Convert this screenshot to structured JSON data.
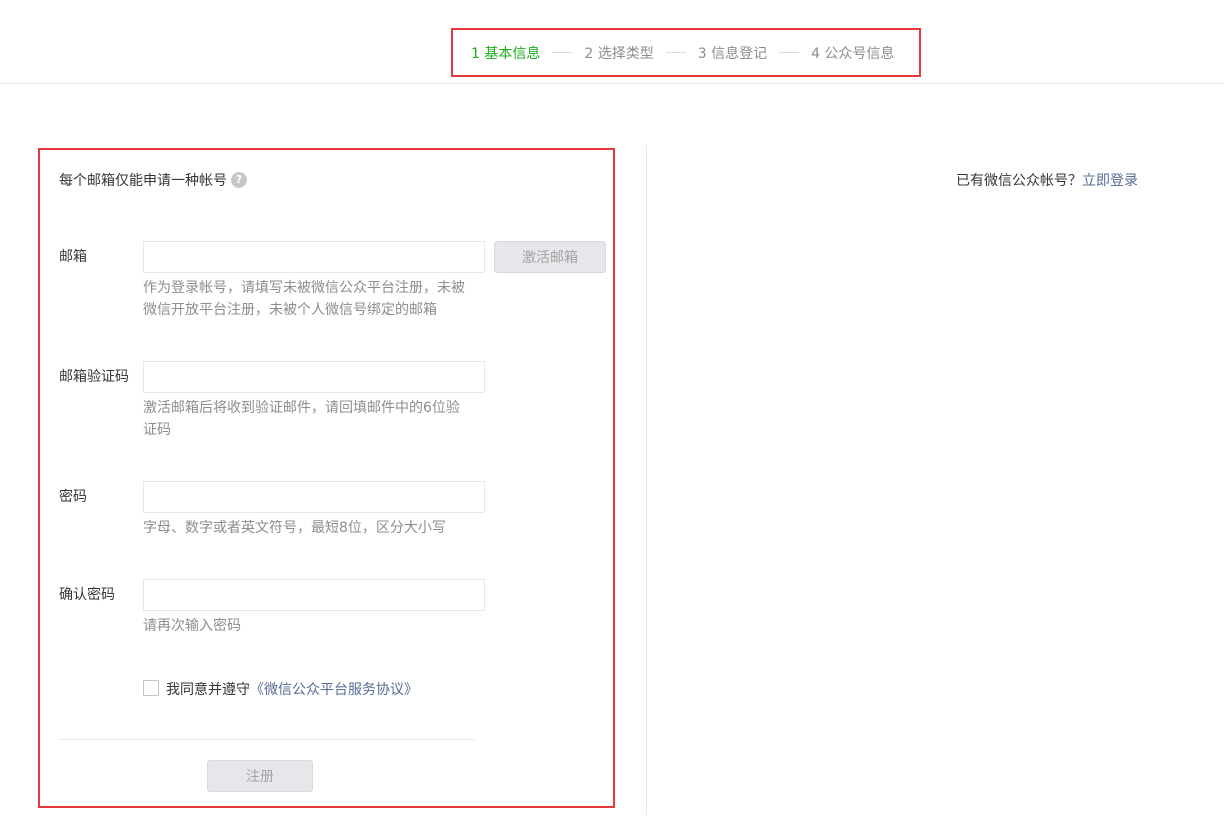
{
  "steps": [
    {
      "label": "1 基本信息",
      "active": true
    },
    {
      "label": "2 选择类型",
      "active": false
    },
    {
      "label": "3 信息登记",
      "active": false
    },
    {
      "label": "4 公众号信息",
      "active": false
    }
  ],
  "notice": {
    "text": "每个邮箱仅能申请一种帐号",
    "help_icon": "?"
  },
  "login_tip": {
    "text": "已有微信公众帐号？",
    "link": "立即登录"
  },
  "form": {
    "email": {
      "label": "邮箱",
      "value": "",
      "hint": "作为登录帐号，请填写未被微信公众平台注册，未被微信开放平台注册，未被个人微信号绑定的邮箱",
      "activate_button": "激活邮箱"
    },
    "verify_code": {
      "label": "邮箱验证码",
      "value": "",
      "hint": "激活邮箱后将收到验证邮件，请回填邮件中的6位验证码"
    },
    "password": {
      "label": "密码",
      "value": "",
      "hint": "字母、数字或者英文符号，最短8位，区分大小写"
    },
    "confirm_password": {
      "label": "确认密码",
      "value": "",
      "hint": "请再次输入密码"
    },
    "agreement": {
      "prefix": "我同意并遵守",
      "link": "《微信公众平台服务协议》",
      "checked": false
    },
    "submit_button": "注册"
  },
  "colors": {
    "accent_green": "#1aad19",
    "link_blue": "#576b95",
    "highlight_red": "#e8393c"
  }
}
